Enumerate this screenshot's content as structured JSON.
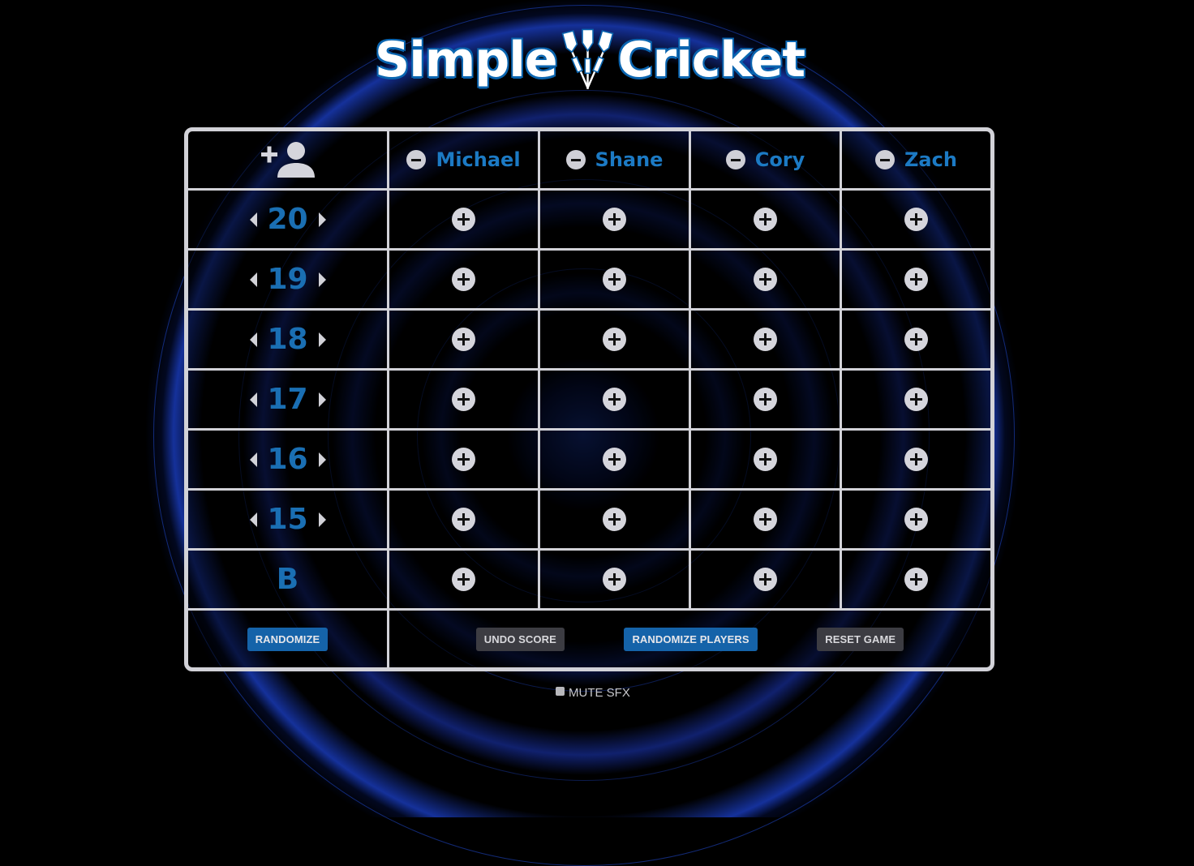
{
  "app": {
    "logo_left": "Simple",
    "logo_right": "Cricket"
  },
  "players": [
    {
      "name": "Michael"
    },
    {
      "name": "Shane"
    },
    {
      "name": "Cory"
    },
    {
      "name": "Zach"
    }
  ],
  "targets": [
    "20",
    "19",
    "18",
    "17",
    "16",
    "15",
    "B"
  ],
  "buttons": {
    "randomize": "RANDOMIZE",
    "undo_score": "UNDO SCORE",
    "randomize_players": "RANDOMIZE PLAYERS",
    "reset_game": "RESET GAME"
  },
  "mute_label": "MUTE SFX",
  "icons": {
    "add_player": "add-player-icon",
    "remove_player": "minus-circle-icon",
    "add_mark": "plus-circle-icon",
    "prev_target": "caret-left-icon",
    "next_target": "caret-right-icon"
  },
  "colors": {
    "accent": "#1a6fb3",
    "button_blue": "#1563a9",
    "button_gray": "#3c3c42",
    "grid": "#d2d2d8",
    "ring": "#2850ff"
  }
}
